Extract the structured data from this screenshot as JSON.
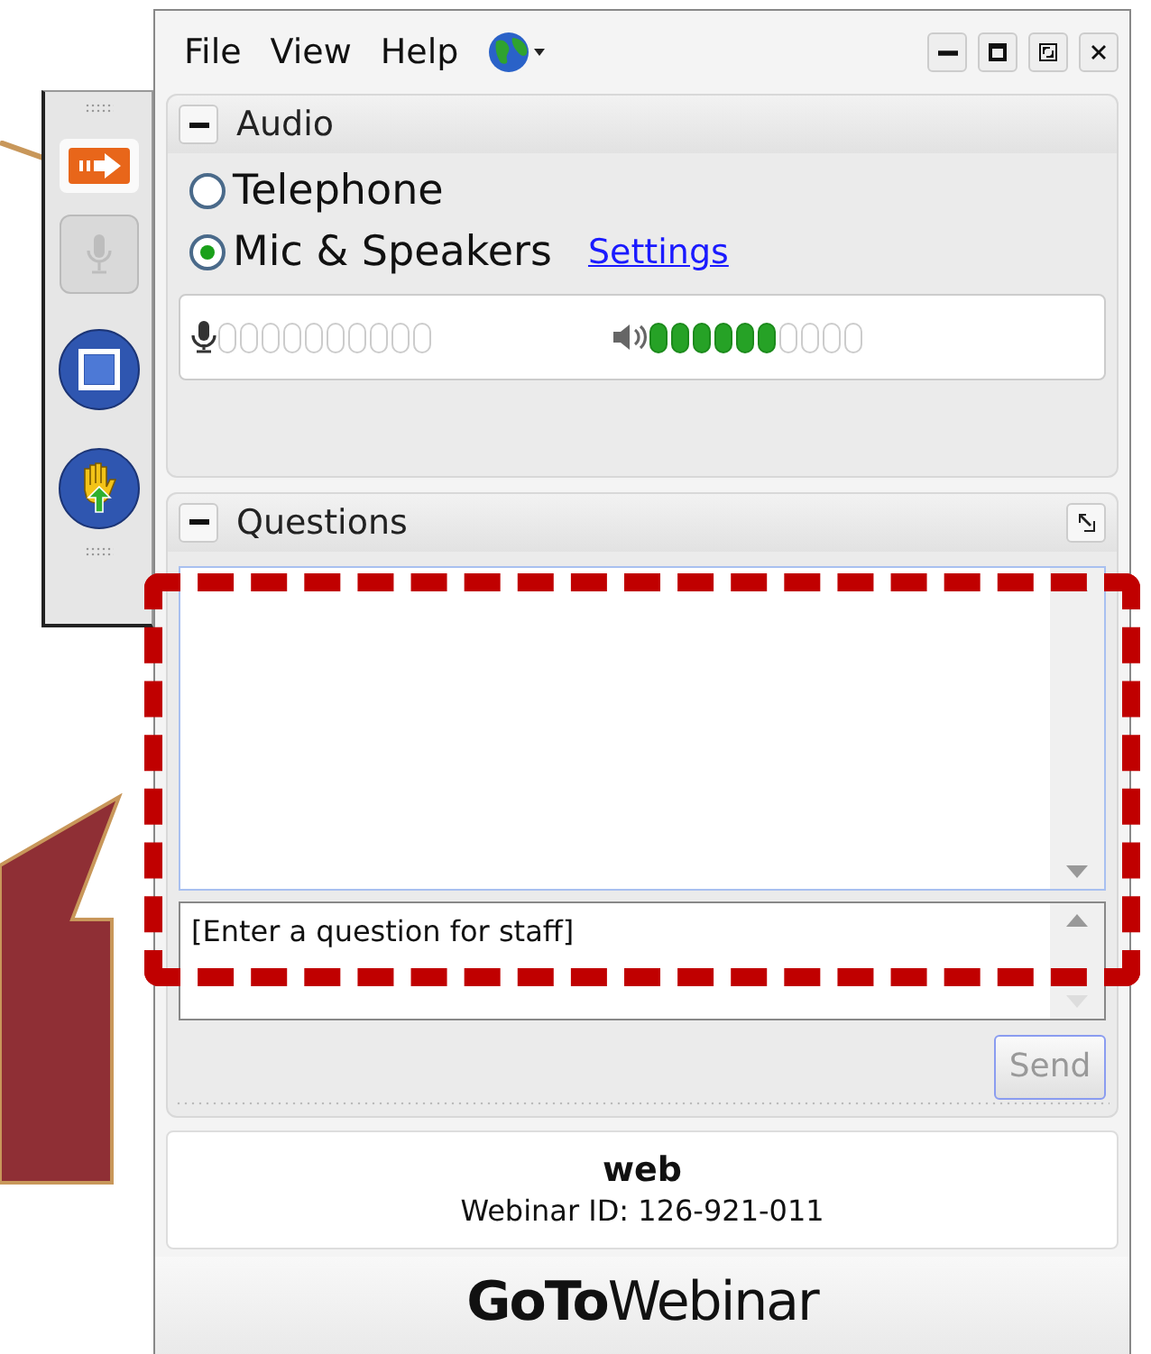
{
  "toolbar": {
    "buttons": [
      {
        "kind": "arrow",
        "disabled": false
      },
      {
        "kind": "mic",
        "disabled": true
      },
      {
        "kind": "screen",
        "disabled": false
      },
      {
        "kind": "hand",
        "disabled": false
      }
    ]
  },
  "menu": [
    {
      "label": "File"
    },
    {
      "label": "View"
    },
    {
      "label": "Help"
    }
  ],
  "audio": {
    "title": "Audio",
    "options": [
      {
        "label": "Telephone",
        "selected": false
      },
      {
        "label": "Mic & Speakers",
        "selected": true
      }
    ],
    "settings_link": "Settings",
    "speakers": {
      "level": 0.6
    }
  },
  "questions": {
    "title": "Questions",
    "input": {
      "placeholder": "[Enter a question for staff]"
    },
    "send": {
      "label": "Send",
      "disabled": true
    }
  },
  "session": {
    "name": "web",
    "webinar_id": "Webinar ID: 126-921-011"
  },
  "logo": "**GoTo**Webinar"
}
